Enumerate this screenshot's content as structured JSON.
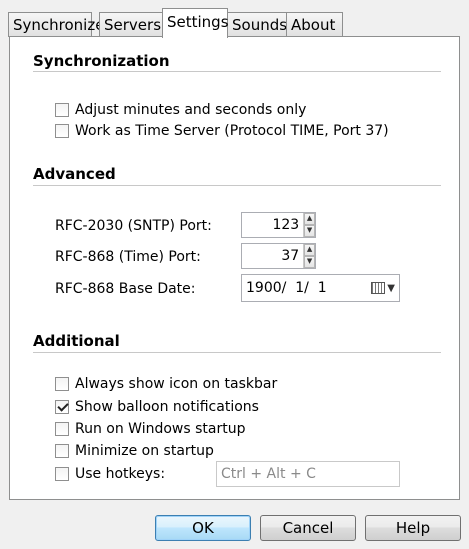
{
  "tabs": [
    "Synchronize",
    "Servers",
    "Settings",
    "Sounds",
    "About"
  ],
  "active_tab": "Settings",
  "synchronization": {
    "title": "Synchronization",
    "adjust_label": "Adjust minutes and seconds only",
    "adjust_checked": false,
    "time_server_label": "Work as Time Server (Protocol TIME, Port 37)",
    "time_server_checked": false
  },
  "advanced": {
    "title": "Advanced",
    "sntp_label": "RFC-2030 (SNTP)  Port:",
    "sntp_port": "123",
    "time_label": "RFC-868 (Time)  Port:",
    "time_port": "37",
    "base_date_label": "RFC-868 Base Date:",
    "base_date": "1900/  1/  1"
  },
  "additional": {
    "title": "Additional",
    "items": [
      {
        "label": "Always show icon on taskbar",
        "checked": false
      },
      {
        "label": "Show balloon notifications",
        "checked": true
      },
      {
        "label": "Run on Windows startup",
        "checked": false
      },
      {
        "label": "Minimize on startup",
        "checked": false
      },
      {
        "label": "Use hotkeys:",
        "checked": false
      }
    ],
    "hotkey_value": "Ctrl + Alt + C"
  },
  "buttons": {
    "ok": "OK",
    "cancel": "Cancel",
    "help": "Help"
  },
  "icons": {
    "spin_up": "▲",
    "spin_down": "▼",
    "dropdown": "▼"
  }
}
